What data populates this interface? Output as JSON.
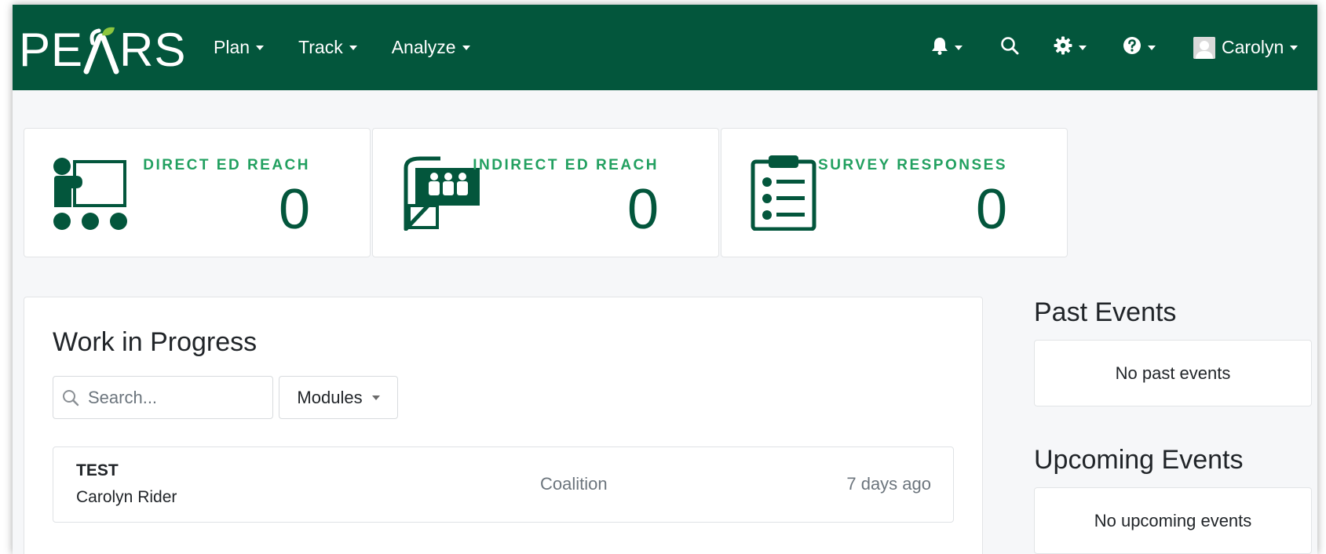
{
  "brand": {
    "logo_text_left": "PE",
    "logo_text_right": "RS"
  },
  "nav": {
    "menus": [
      {
        "label": "Plan"
      },
      {
        "label": "Track"
      },
      {
        "label": "Analyze"
      }
    ],
    "user": {
      "name": "Carolyn"
    },
    "icons": [
      "bell-icon",
      "search-icon",
      "gear-icon",
      "help-icon",
      "avatar"
    ]
  },
  "stats": [
    {
      "label": "DIRECT ED REACH",
      "value": "0",
      "icon": "direct-ed-icon"
    },
    {
      "label": "INDIRECT ED REACH",
      "value": "0",
      "icon": "indirect-ed-icon"
    },
    {
      "label": "SURVEY RESPONSES",
      "value": "0",
      "icon": "clipboard-icon"
    }
  ],
  "work_in_progress": {
    "title": "Work in Progress",
    "search_placeholder": "Search...",
    "modules_label": "Modules",
    "rows": [
      {
        "title": "TEST",
        "user": "Carolyn Rider",
        "module": "Coalition",
        "time": "7 days ago"
      }
    ]
  },
  "past_events": {
    "title": "Past Events",
    "empty_text": "No past events"
  },
  "upcoming_events": {
    "title": "Upcoming Events",
    "empty_text": "No upcoming events"
  },
  "colors": {
    "navbar": "#03563c",
    "accent_green": "#22a060",
    "dark_green": "#03563c"
  }
}
